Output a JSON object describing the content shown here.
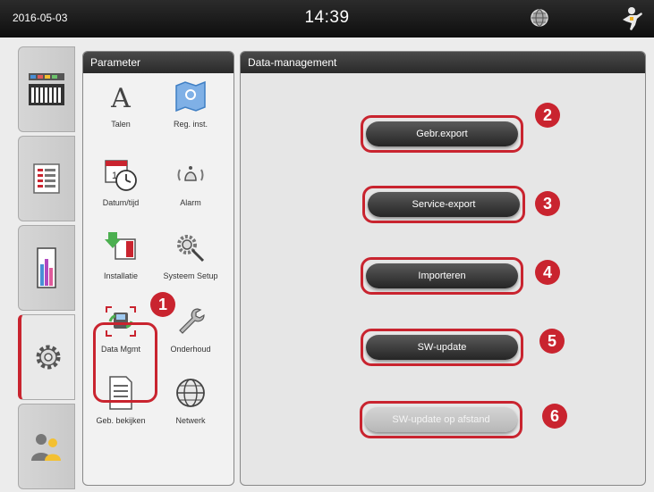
{
  "status_bar": {
    "date": "2016-05-03",
    "time": "14:39",
    "globe_icon": "globe-icon",
    "user_icon": "user-icon"
  },
  "side_tabs": [
    {
      "icon": "station-icon"
    },
    {
      "icon": "program-list-icon"
    },
    {
      "icon": "reagent-icon"
    },
    {
      "icon": "gear-icon"
    },
    {
      "icon": "user-login-icon"
    }
  ],
  "parameter_panel": {
    "title": "Parameter",
    "items": [
      {
        "label": "Talen",
        "icon": "letter-icon"
      },
      {
        "label": "Reg. inst.",
        "icon": "map-icon"
      },
      {
        "label": "Datum/tijd",
        "icon": "calendar-clock-icon"
      },
      {
        "label": "Alarm",
        "icon": "alarm-icon"
      },
      {
        "label": "Installatie",
        "icon": "installation-icon"
      },
      {
        "label": "Systeem Setup",
        "icon": "system-setup-icon"
      },
      {
        "label": "Data Mgmt",
        "icon": "data-management-icon"
      },
      {
        "label": "Onderhoud",
        "icon": "wrench-icon"
      },
      {
        "label": "Geb. bekijken",
        "icon": "document-icon"
      },
      {
        "label": "Netwerk",
        "icon": "network-icon"
      }
    ]
  },
  "data_panel": {
    "title": "Data-management",
    "buttons": [
      {
        "label": "Gebr.export",
        "enabled": true
      },
      {
        "label": "Service-export",
        "enabled": true
      },
      {
        "label": "Importeren",
        "enabled": true
      },
      {
        "label": "SW-update",
        "enabled": true
      },
      {
        "label": "SW-update op afstand",
        "enabled": false
      }
    ]
  },
  "callouts": [
    "1",
    "2",
    "3",
    "4",
    "5",
    "6"
  ],
  "colors": {
    "accent_red": "#c9242f",
    "header_dark": "#2a2a2a",
    "button_dark": "#3a3a3a",
    "button_disabled": "#c4c4c4"
  }
}
